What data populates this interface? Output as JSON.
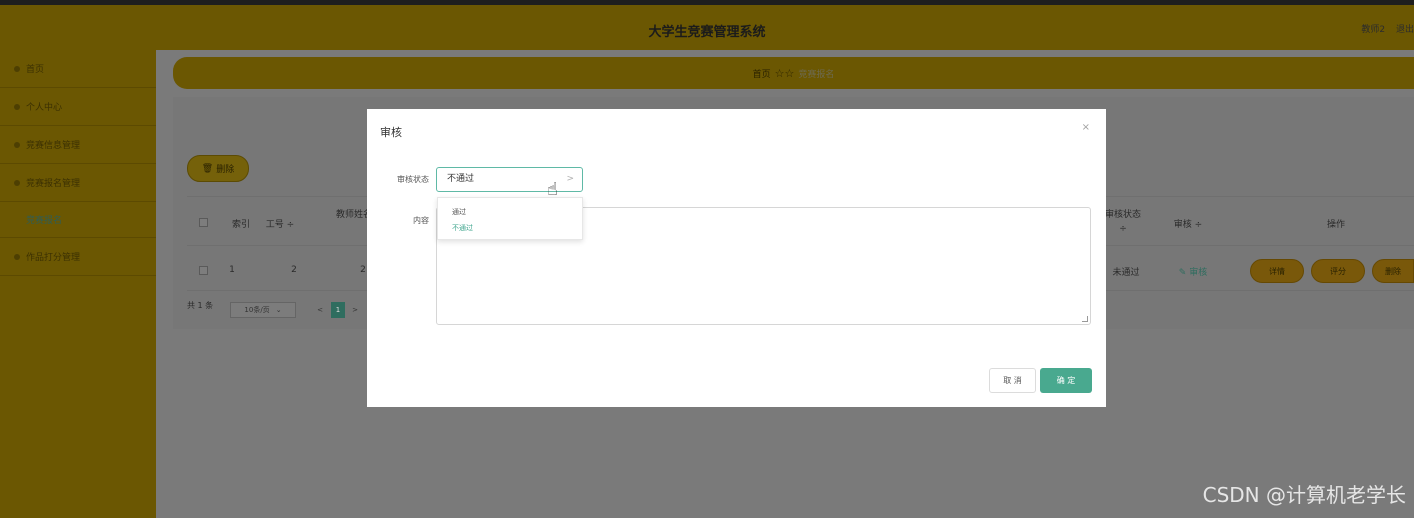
{
  "header": {
    "title": "大学生竞赛管理系统",
    "user": "教师2",
    "logout": "退出"
  },
  "sidebar": {
    "items": [
      {
        "label": "首页"
      },
      {
        "label": "个人中心"
      },
      {
        "label": "竞赛信息管理"
      },
      {
        "label": "竞赛报名管理"
      },
      {
        "label": "竞赛报名"
      },
      {
        "label": "作品打分管理"
      }
    ]
  },
  "breadcrumb": {
    "home": "首页",
    "stars": "☆☆",
    "current": "竞赛报名"
  },
  "toolbar": {
    "delete_label": "删除"
  },
  "table": {
    "headers": {
      "index": "索引",
      "job_no": "工号 ÷",
      "teacher": "教师姓名 ÷",
      "review_status": "审核状态",
      "review_status_sort": "÷",
      "review": "审核 ÷",
      "ops": "操作"
    },
    "rows": [
      {
        "index": "1",
        "job_no": "2",
        "teacher": "2",
        "review_status": "未通过",
        "review_link": "审核",
        "ops": {
          "detail": "详情",
          "score": "评分",
          "delete": "删除"
        }
      }
    ]
  },
  "pagination": {
    "total": "共 1 条",
    "page_size": "10条/页",
    "prev": "<",
    "current_page": "1",
    "next": ">"
  },
  "modal": {
    "title": "审核",
    "close": "×",
    "status_label": "审核状态",
    "status_value": "不通过",
    "content_label": "内容",
    "options": [
      "通过",
      "不通过"
    ],
    "cancel": "取 消",
    "ok": "确 定"
  },
  "watermark": "CSDN @计算机老学长"
}
